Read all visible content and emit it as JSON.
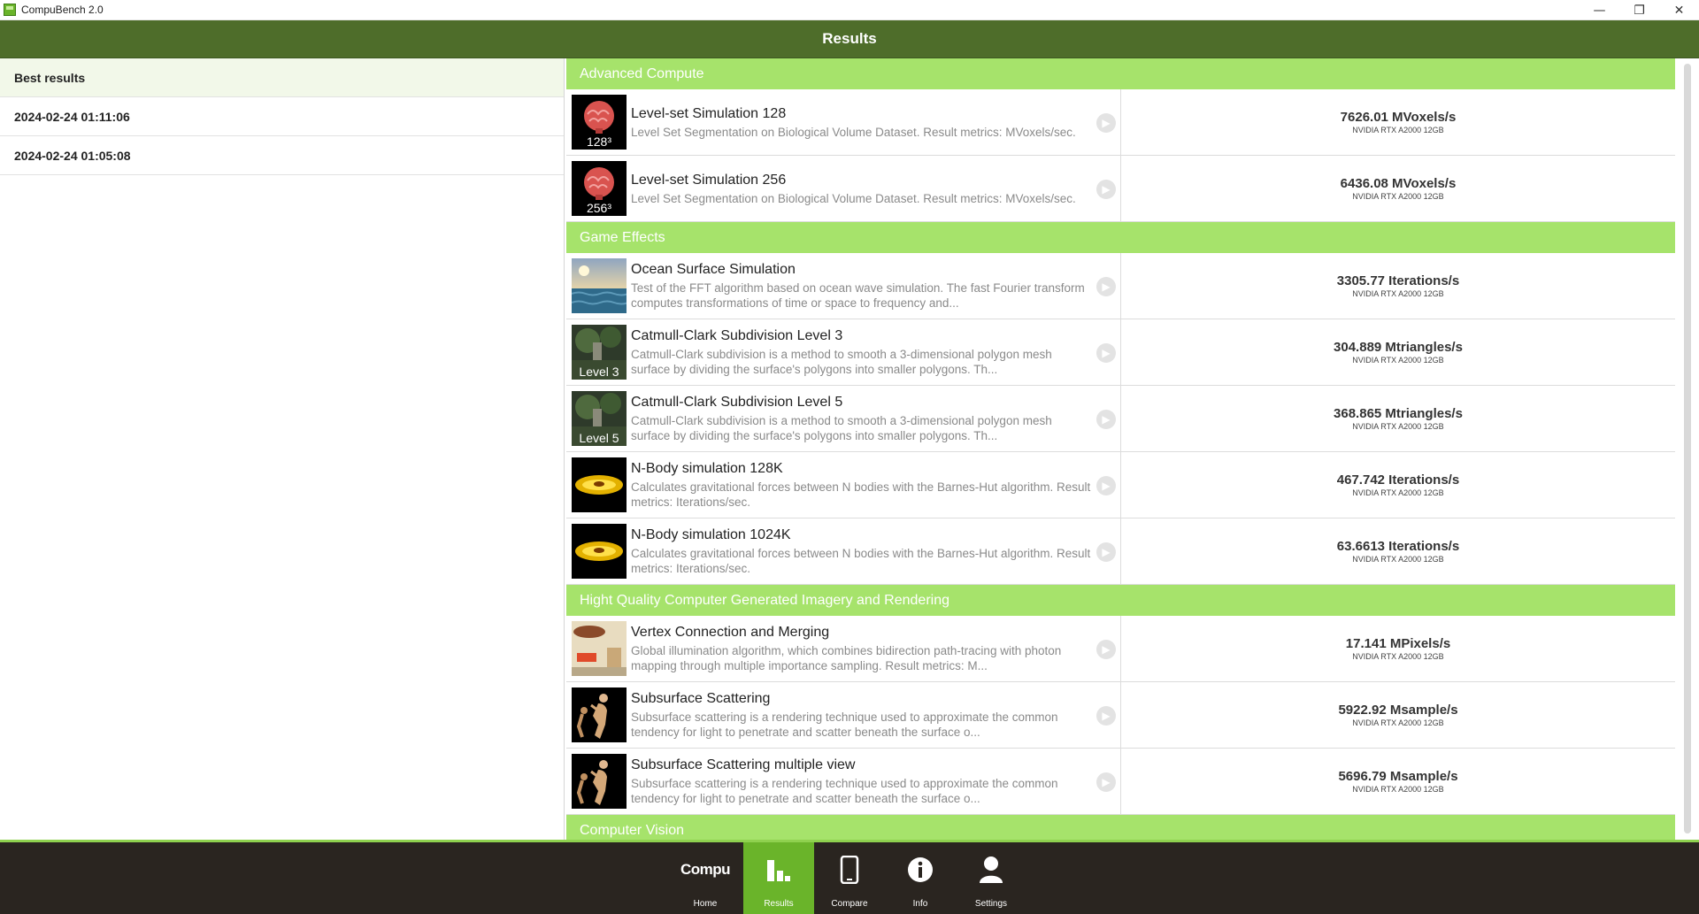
{
  "window": {
    "title": "CompuBench 2.0",
    "controls": {
      "minimize": "—",
      "restore": "❐",
      "close": "✕"
    }
  },
  "header": {
    "title": "Results"
  },
  "sidebar": {
    "items": [
      {
        "label": "Best results"
      },
      {
        "label": "2024-02-24 01:11:06"
      },
      {
        "label": "2024-02-24 01:05:08"
      }
    ]
  },
  "results": {
    "categories": [
      {
        "name": "Advanced Compute",
        "rows": [
          {
            "name": "Level-set Simulation 128",
            "desc": "Level Set Segmentation on Biological Volume Dataset. Result metrics: MVoxels/sec.",
            "thumb_label": "128³",
            "thumb": "brain-icon",
            "score": "7626.01 MVoxels/s",
            "device": "NVIDIA RTX A2000 12GB"
          },
          {
            "name": "Level-set Simulation 256",
            "desc": "Level Set Segmentation on Biological Volume Dataset. Result metrics: MVoxels/sec.",
            "thumb_label": "256³",
            "thumb": "brain-icon",
            "score": "6436.08 MVoxels/s",
            "device": "NVIDIA RTX A2000 12GB"
          }
        ]
      },
      {
        "name": "Game Effects",
        "rows": [
          {
            "name": "Ocean Surface Simulation",
            "desc": "Test of the FFT algorithm based on ocean wave simulation. The fast Fourier transform computes transformations of time or space to frequency and...",
            "thumb_label": "",
            "thumb": "ocean-icon",
            "score": "3305.77 Iterations/s",
            "device": "NVIDIA RTX A2000 12GB"
          },
          {
            "name": "Catmull-Clark Subdivision Level 3",
            "desc": "Catmull-Clark subdivision is a method to smooth a 3-dimensional polygon mesh surface by dividing the surface's polygons into smaller polygons. Th...",
            "thumb_label": "Level 3",
            "thumb": "forest-icon",
            "score": "304.889 Mtriangles/s",
            "device": "NVIDIA RTX A2000 12GB"
          },
          {
            "name": "Catmull-Clark Subdivision Level 5",
            "desc": "Catmull-Clark subdivision is a method to smooth a 3-dimensional polygon mesh surface by dividing the surface's polygons into smaller polygons. Th...",
            "thumb_label": "Level 5",
            "thumb": "forest-icon",
            "score": "368.865 Mtriangles/s",
            "device": "NVIDIA RTX A2000 12GB"
          },
          {
            "name": "N-Body simulation 128K",
            "desc": "Calculates gravitational forces between N bodies with the Barnes-Hut algorithm. Result metrics: Iterations/sec.",
            "thumb_label": "",
            "thumb": "galaxy-icon",
            "score": "467.742 Iterations/s",
            "device": "NVIDIA RTX A2000 12GB"
          },
          {
            "name": "N-Body simulation 1024K",
            "desc": "Calculates gravitational forces between N bodies with the Barnes-Hut algorithm. Result metrics: Iterations/sec.",
            "thumb_label": "",
            "thumb": "galaxy-icon",
            "score": "63.6613 Iterations/s",
            "device": "NVIDIA RTX A2000 12GB"
          }
        ]
      },
      {
        "name": "Hight Quality Computer Generated Imagery and Rendering",
        "rows": [
          {
            "name": "Vertex Connection and Merging",
            "desc": "Global illumination algorithm, which combines bidirection path-tracing with photon mapping through multiple importance sampling. Result metrics: M...",
            "thumb_label": "",
            "thumb": "scene-icon",
            "score": "17.141 MPixels/s",
            "device": "NVIDIA RTX A2000 12GB"
          },
          {
            "name": "Subsurface Scattering",
            "desc": "Subsurface scattering is a rendering technique used to approximate the common tendency for light to penetrate and scatter beneath the surface o...",
            "thumb_label": "",
            "thumb": "statue-icon",
            "score": "5922.92 Msample/s",
            "device": "NVIDIA RTX A2000 12GB"
          },
          {
            "name": "Subsurface Scattering multiple view",
            "desc": "Subsurface scattering is a rendering technique used to approximate the common tendency for light to penetrate and scatter beneath the surface o...",
            "thumb_label": "",
            "thumb": "statue-icon",
            "score": "5696.79 Msample/s",
            "device": "NVIDIA RTX A2000 12GB"
          }
        ]
      },
      {
        "name": "Computer Vision",
        "rows": []
      }
    ]
  },
  "nav": {
    "logo": "Compu",
    "items": [
      {
        "label": "Home",
        "icon": "compu-logo-icon"
      },
      {
        "label": "Results",
        "icon": "bar-chart-icon",
        "active": true
      },
      {
        "label": "Compare",
        "icon": "phone-icon"
      },
      {
        "label": "Info",
        "icon": "info-icon"
      },
      {
        "label": "Settings",
        "icon": "user-icon"
      }
    ]
  },
  "colors": {
    "header_bg": "#4e6d2a",
    "category_bg": "#a6e36b",
    "nav_bg": "#2a2520",
    "nav_active": "#6ab42a"
  }
}
